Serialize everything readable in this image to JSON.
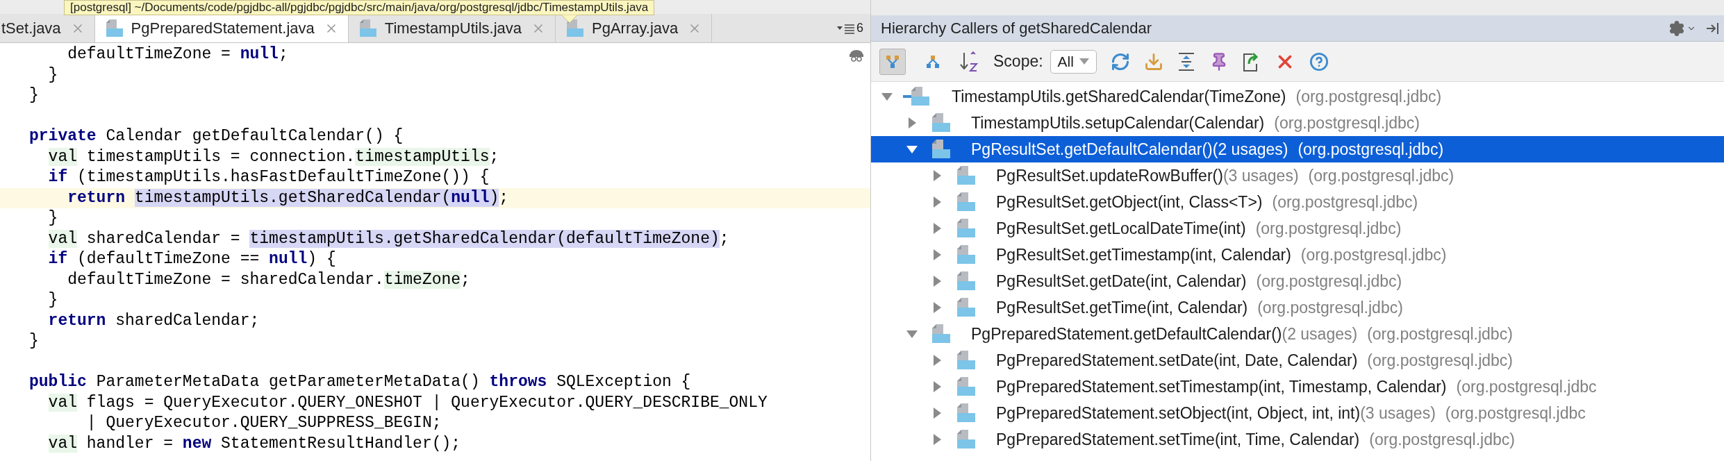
{
  "tooltip": "[postgresql] ~/Documents/code/pgjdbc-all/pgjdbc/pgjdbc/src/main/java/org/postgresql/jdbc/TimestampUtils.java",
  "editor_tabs": [
    {
      "label": "tSet.java",
      "selected": false
    },
    {
      "label": "PgPreparedStatement.java",
      "selected": true
    },
    {
      "label": "TimestampUtils.java",
      "selected": false
    },
    {
      "label": "PgArray.java",
      "selected": false
    }
  ],
  "tab_overflow_count": "6",
  "code_lines": [
    {
      "current": false,
      "tokens": [
        {
          "kind": "plain",
          "text": "    defaultTimeZone = "
        },
        {
          "kind": "kw",
          "text": "null"
        },
        {
          "kind": "plain",
          "text": ";"
        }
      ]
    },
    {
      "current": false,
      "tokens": [
        {
          "kind": "plain",
          "text": "  }"
        }
      ]
    },
    {
      "current": false,
      "blank_after": true,
      "tokens": [
        {
          "kind": "plain",
          "text": "}"
        }
      ]
    },
    {
      "current": false,
      "tokens": [
        {
          "kind": "kw",
          "text": "private"
        },
        {
          "kind": "plain",
          "text": " Calendar getDefaultCalendar() {"
        }
      ]
    },
    {
      "current": false,
      "tokens": [
        {
          "kind": "field",
          "text": "  val"
        },
        {
          "kind": "plain",
          "text": " timestampUtils = connection."
        },
        {
          "kind": "field",
          "text": "timestampUtils"
        },
        {
          "kind": "plain",
          "text": ";"
        }
      ]
    },
    {
      "current": false,
      "tokens": [
        {
          "kind": "kw",
          "text": "  if"
        },
        {
          "kind": "plain",
          "text": " (timestampUtils.hasFastDefaultTimeZone()) {"
        }
      ]
    },
    {
      "current": true,
      "tokens": [
        {
          "kind": "kw",
          "text": "    return "
        },
        {
          "kind": "hl",
          "text": "timestampUtils.getSharedCalendar("
        },
        {
          "kind": "hlkw",
          "text": "null"
        },
        {
          "kind": "hl",
          "text": ")"
        },
        {
          "kind": "plain",
          "text": ";"
        }
      ]
    },
    {
      "current": false,
      "tokens": [
        {
          "kind": "plain",
          "text": "  }"
        }
      ]
    },
    {
      "current": false,
      "tokens": [
        {
          "kind": "field",
          "text": "  val"
        },
        {
          "kind": "plain",
          "text": " sharedCalendar = "
        },
        {
          "kind": "hl",
          "text": "timestampUtils.getSharedCalendar(defaultTimeZone)"
        },
        {
          "kind": "plain",
          "text": ";"
        }
      ]
    },
    {
      "current": false,
      "tokens": [
        {
          "kind": "kw",
          "text": "  if"
        },
        {
          "kind": "plain",
          "text": " (defaultTimeZone == "
        },
        {
          "kind": "kw",
          "text": "null"
        },
        {
          "kind": "plain",
          "text": ") {"
        }
      ]
    },
    {
      "current": false,
      "tokens": [
        {
          "kind": "plain",
          "text": "    defaultTimeZone = sharedCalendar."
        },
        {
          "kind": "field",
          "text": "timeZone"
        },
        {
          "kind": "plain",
          "text": ";"
        }
      ]
    },
    {
      "current": false,
      "tokens": [
        {
          "kind": "plain",
          "text": "  }"
        }
      ]
    },
    {
      "current": false,
      "tokens": [
        {
          "kind": "kw",
          "text": "  return"
        },
        {
          "kind": "plain",
          "text": " sharedCalendar;"
        }
      ]
    },
    {
      "current": false,
      "blank_after": true,
      "tokens": [
        {
          "kind": "plain",
          "text": "}"
        }
      ]
    },
    {
      "current": false,
      "tokens": [
        {
          "kind": "kw",
          "text": "public"
        },
        {
          "kind": "plain",
          "text": " ParameterMetaData getParameterMetaData() "
        },
        {
          "kind": "kw",
          "text": "throws"
        },
        {
          "kind": "plain",
          "text": " SQLException {"
        }
      ]
    },
    {
      "current": false,
      "tokens": [
        {
          "kind": "field",
          "text": "  val"
        },
        {
          "kind": "plain",
          "text": " flags = QueryExecutor.QUERY_ONESHOT | QueryExecutor.QUERY_DESCRIBE_ONLY"
        }
      ]
    },
    {
      "current": false,
      "tokens": [
        {
          "kind": "plain",
          "text": "      | QueryExecutor.QUERY_SUPPRESS_BEGIN;"
        }
      ]
    },
    {
      "current": false,
      "tokens": [
        {
          "kind": "field",
          "text": "  val"
        },
        {
          "kind": "plain",
          "text": " handler = "
        },
        {
          "kind": "kw",
          "text": "new"
        },
        {
          "kind": "plain",
          "text": " StatementResultHandler();"
        }
      ]
    }
  ],
  "hierarchy": {
    "title": "Hierarchy Callers of getSharedCalendar",
    "view_modes": [
      {
        "selected": true
      },
      {
        "selected": false
      }
    ],
    "scope_label": "Scope:",
    "scope_value": "All",
    "tree": [
      {
        "kind": "target",
        "method": "TimestampUtils.getSharedCalendar(TimeZone)",
        "package": "(org.postgresql.jdbc)",
        "expanded": true,
        "selected": false,
        "children": [
          {
            "kind": "caller",
            "method": "TimestampUtils.setupCalendar(Calendar)",
            "package": "(org.postgresql.jdbc)",
            "expanded": false,
            "selected": false
          },
          {
            "kind": "caller",
            "method": "PgResultSet.getDefaultCalendar()",
            "usages": "(2 usages)",
            "package": "(org.postgresql.jdbc)",
            "expanded": true,
            "selected": true,
            "children": [
              {
                "kind": "caller",
                "method": "PgResultSet.updateRowBuffer()",
                "usages": "(3 usages)",
                "package": "(org.postgresql.jdbc)",
                "expanded": false,
                "selected": false
              },
              {
                "kind": "caller",
                "method": "PgResultSet.getObject(int, Class<T>)",
                "package": "(org.postgresql.jdbc)",
                "expanded": false,
                "selected": false
              },
              {
                "kind": "caller",
                "method": "PgResultSet.getLocalDateTime(int)",
                "package": "(org.postgresql.jdbc)",
                "expanded": false,
                "selected": false
              },
              {
                "kind": "caller",
                "method": "PgResultSet.getTimestamp(int, Calendar)",
                "package": "(org.postgresql.jdbc)",
                "expanded": false,
                "selected": false
              },
              {
                "kind": "caller",
                "method": "PgResultSet.getDate(int, Calendar)",
                "package": "(org.postgresql.jdbc)",
                "expanded": false,
                "selected": false
              },
              {
                "kind": "caller",
                "method": "PgResultSet.getTime(int, Calendar)",
                "package": "(org.postgresql.jdbc)",
                "expanded": false,
                "selected": false
              }
            ]
          },
          {
            "kind": "caller",
            "method": "PgPreparedStatement.getDefaultCalendar()",
            "usages": "(2 usages)",
            "package": "(org.postgresql.jdbc)",
            "expanded": true,
            "selected": false,
            "children": [
              {
                "kind": "caller",
                "method": "PgPreparedStatement.setDate(int, Date, Calendar)",
                "package": "(org.postgresql.jdbc)",
                "expanded": false,
                "selected": false
              },
              {
                "kind": "caller",
                "method": "PgPreparedStatement.setTimestamp(int, Timestamp, Calendar)",
                "package": "(org.postgresql.jdbc",
                "expanded": false,
                "selected": false
              },
              {
                "kind": "caller",
                "method": "PgPreparedStatement.setObject(int, Object, int, int)",
                "usages": "(3 usages)",
                "package": "(org.postgresql.jdbc",
                "expanded": false,
                "selected": false
              },
              {
                "kind": "caller",
                "method": "PgPreparedStatement.setTime(int, Time, Calendar)",
                "package": "(org.postgresql.jdbc)",
                "expanded": false,
                "selected": false
              }
            ]
          }
        ]
      }
    ]
  }
}
